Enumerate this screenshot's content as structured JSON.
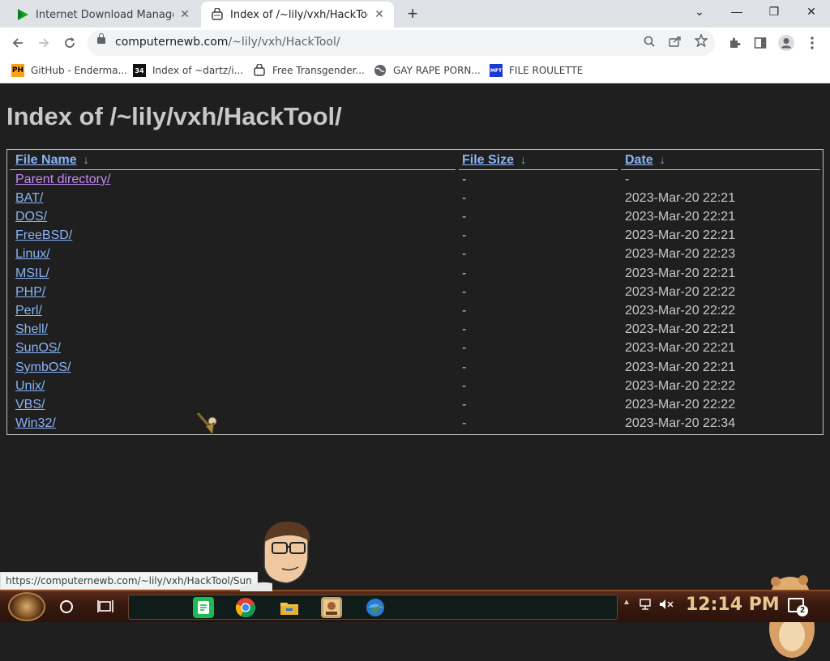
{
  "browser": {
    "tabs": [
      {
        "label": "Internet Download Manager: T",
        "close": "✕"
      },
      {
        "label": "Index of /~lily/vxh/HackTool/",
        "close": "✕"
      }
    ],
    "new_tab": "+",
    "window_controls": {
      "tab_search": "⌄",
      "minimize": "—",
      "restore": "❐",
      "close": "✕"
    },
    "address": {
      "host": "computernewb.com",
      "path": "/~lily/vxh/HackTool/"
    },
    "bookmarks": [
      {
        "label": "GitHub - Enderma...",
        "icon_text": "PH",
        "icon": "pornhub-favicon"
      },
      {
        "label": "Index of ~dartz/i...",
        "icon_text": "34",
        "icon": "grid-favicon"
      },
      {
        "label": "Free Transgender...",
        "icon_text": "",
        "icon": "bag-favicon"
      },
      {
        "label": "GAY RAPE PORN...",
        "icon_text": "",
        "icon": "globe-favicon"
      },
      {
        "label": "FILE ROULETTE",
        "icon_text": "MFT",
        "icon": "file-favicon"
      }
    ]
  },
  "page": {
    "title": "Index of /~lily/vxh/HackTool/",
    "columns": {
      "name": "File Name",
      "size": "File Size",
      "date": "Date",
      "sort_arrow": "↓"
    },
    "rows": [
      {
        "name": "Parent directory/",
        "size": "-",
        "date": "-"
      },
      {
        "name": "BAT/",
        "size": "-",
        "date": "2023-Mar-20 22:21"
      },
      {
        "name": "DOS/",
        "size": "-",
        "date": "2023-Mar-20 22:21"
      },
      {
        "name": "FreeBSD/",
        "size": "-",
        "date": "2023-Mar-20 22:21"
      },
      {
        "name": "Linux/",
        "size": "-",
        "date": "2023-Mar-20 22:23"
      },
      {
        "name": "MSIL/",
        "size": "-",
        "date": "2023-Mar-20 22:21"
      },
      {
        "name": "PHP/",
        "size": "-",
        "date": "2023-Mar-20 22:22"
      },
      {
        "name": "Perl/",
        "size": "-",
        "date": "2023-Mar-20 22:22"
      },
      {
        "name": "Shell/",
        "size": "-",
        "date": "2023-Mar-20 22:21"
      },
      {
        "name": "SunOS/",
        "size": "-",
        "date": "2023-Mar-20 22:21"
      },
      {
        "name": "SymbOS/",
        "size": "-",
        "date": "2023-Mar-20 22:21"
      },
      {
        "name": "Unix/",
        "size": "-",
        "date": "2023-Mar-20 22:22"
      },
      {
        "name": "VBS/",
        "size": "-",
        "date": "2023-Mar-20 22:22"
      },
      {
        "name": "Win32/",
        "size": "-",
        "date": "2023-Mar-20 22:34"
      }
    ]
  },
  "status_url": "https://computernewb.com/~lily/vxh/HackTool/Sun",
  "taskbar": {
    "clock": "12:14 PM",
    "notification_count": "2",
    "apps": [
      "notes-app-icon",
      "chrome-icon",
      "file-explorer-icon",
      "browser-app-icon",
      "idm-icon"
    ]
  },
  "colors": {
    "link": "#8ab4f8",
    "visited_link": "#c58af9",
    "page_bg": "#1f1f1f",
    "text": "#c8c8c8"
  }
}
